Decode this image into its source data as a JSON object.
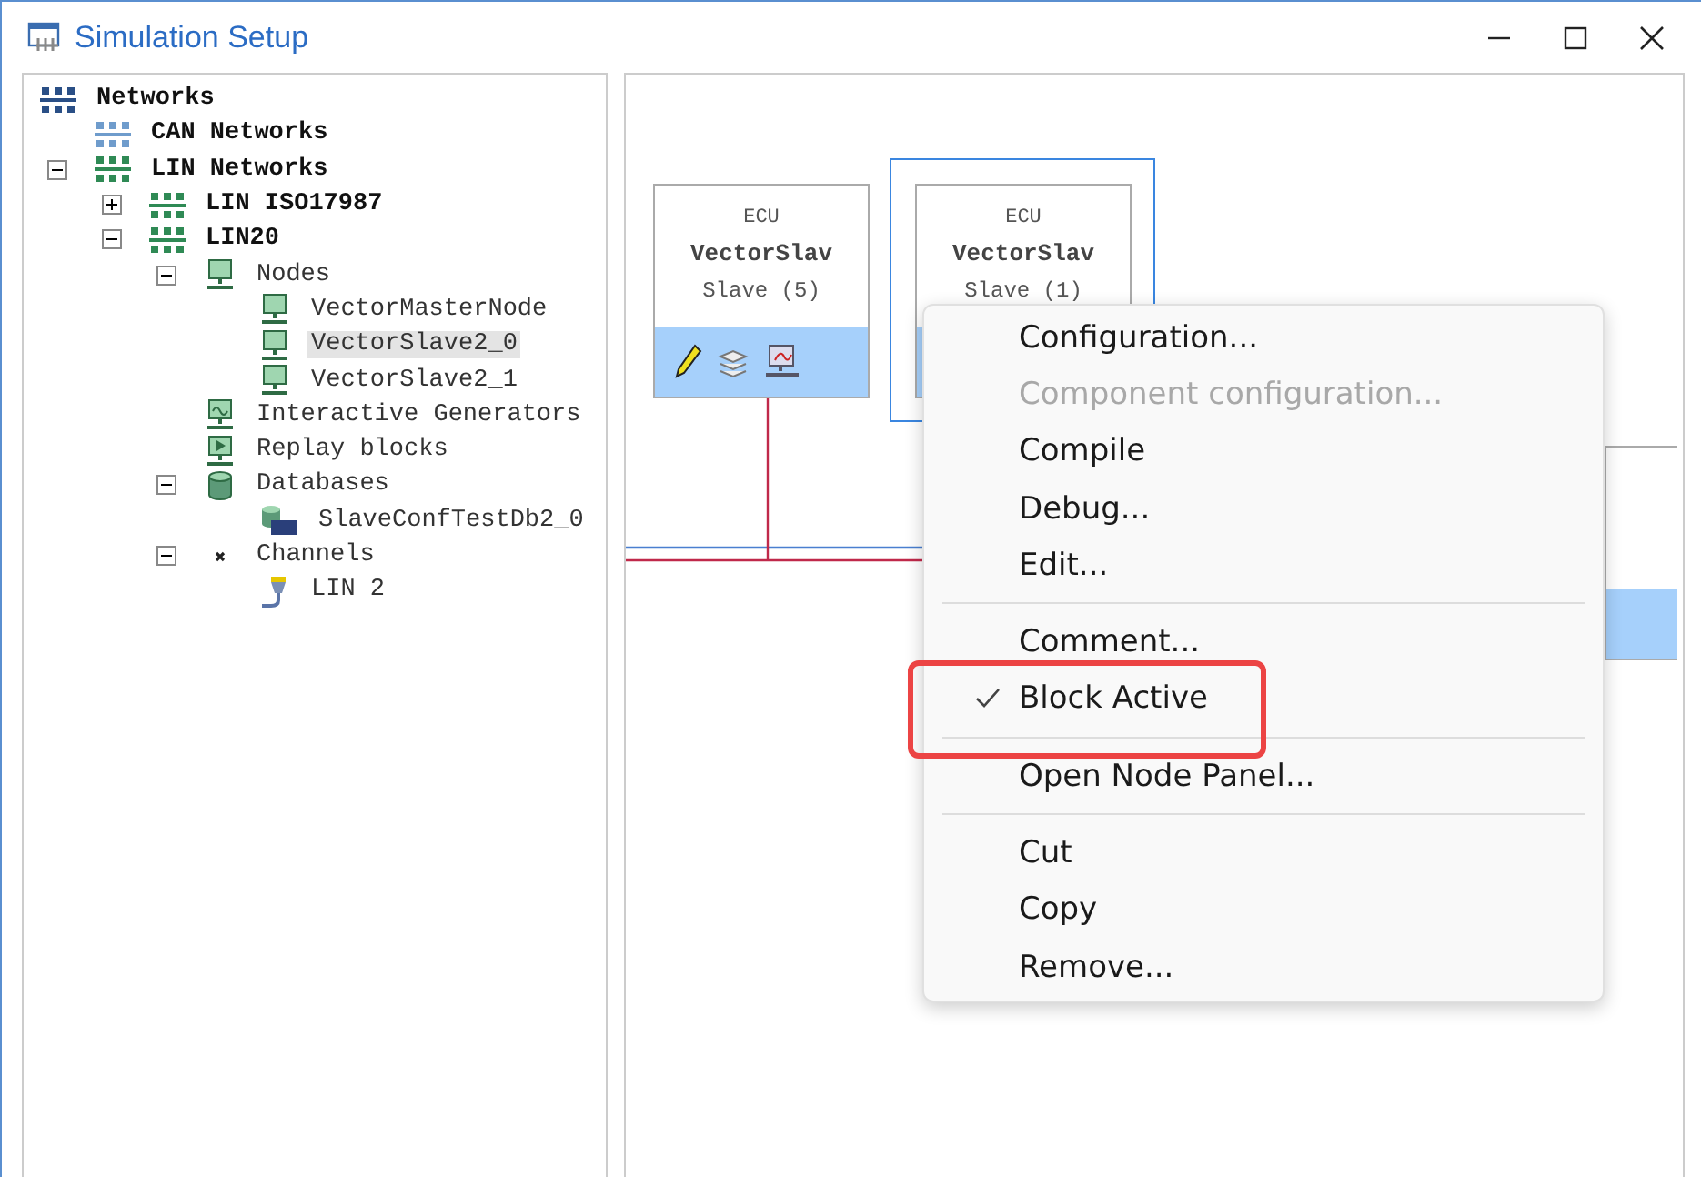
{
  "window": {
    "title": "Simulation Setup"
  },
  "tree": [
    {
      "label": "Networks",
      "kind": "network-root",
      "bold": true,
      "selected": false,
      "children": [
        {
          "label": "CAN Networks",
          "kind": "network-can",
          "bold": true,
          "selected": false
        },
        {
          "label": "LIN Networks",
          "kind": "network-lin",
          "bold": true,
          "selected": false,
          "expanded": true,
          "children": [
            {
              "label": "LIN ISO17987",
              "kind": "network-lin",
              "bold": true,
              "selected": false,
              "expanded": false
            },
            {
              "label": "LIN20",
              "kind": "network-lin",
              "bold": true,
              "selected": false,
              "expanded": true,
              "children": [
                {
                  "label": "Nodes",
                  "kind": "node",
                  "bold": false,
                  "selected": false,
                  "expanded": true,
                  "children": [
                    {
                      "label": "VectorMasterNode",
                      "kind": "node",
                      "bold": false,
                      "selected": false
                    },
                    {
                      "label": "VectorSlave2_0",
                      "kind": "node",
                      "bold": false,
                      "selected": true
                    },
                    {
                      "label": "VectorSlave2_1",
                      "kind": "node",
                      "bold": false,
                      "selected": false
                    }
                  ]
                },
                {
                  "label": "Interactive Generators",
                  "kind": "generator",
                  "bold": false,
                  "selected": false
                },
                {
                  "label": "Replay blocks",
                  "kind": "replay",
                  "bold": false,
                  "selected": false
                },
                {
                  "label": "Databases",
                  "kind": "database",
                  "bold": false,
                  "selected": false,
                  "expanded": true,
                  "children": [
                    {
                      "label": "SlaveConfTestDb2_0",
                      "kind": "ldf",
                      "bold": false,
                      "selected": false
                    }
                  ]
                },
                {
                  "label": "Channels",
                  "kind": "channels",
                  "bold": false,
                  "selected": false,
                  "expanded": true,
                  "children": [
                    {
                      "label": "LIN 2",
                      "kind": "channel",
                      "bold": false,
                      "selected": false
                    }
                  ]
                }
              ]
            }
          ]
        }
      ]
    }
  ],
  "blocks": [
    {
      "type": "ECU",
      "name": "VectorSlav",
      "role": "Slave (5)",
      "selected": false,
      "tools": [
        {
          "kind": "edit"
        },
        {
          "kind": "layers"
        },
        {
          "kind": "monitor"
        }
      ]
    },
    {
      "type": "ECU",
      "name": "VectorSlav",
      "role": "Slave (1)",
      "selected": true
    }
  ],
  "context_menu": [
    {
      "kind": "item",
      "label": "Configuration...",
      "disabled": false,
      "checked": false
    },
    {
      "kind": "item",
      "label": "Component configuration...",
      "disabled": true,
      "checked": false
    },
    {
      "kind": "item",
      "label": "Compile",
      "disabled": false,
      "checked": false
    },
    {
      "kind": "item",
      "label": "Debug...",
      "disabled": false,
      "checked": false
    },
    {
      "kind": "item",
      "label": "Edit...",
      "disabled": false,
      "checked": false
    },
    {
      "kind": "separator"
    },
    {
      "kind": "item",
      "label": "Comment...",
      "disabled": false,
      "checked": false
    },
    {
      "kind": "item",
      "label": "Block Active",
      "disabled": false,
      "checked": true,
      "annotated": true
    },
    {
      "kind": "separator"
    },
    {
      "kind": "item",
      "label": "Open Node Panel...",
      "disabled": false,
      "checked": false
    },
    {
      "kind": "separator"
    },
    {
      "kind": "item",
      "label": "Cut",
      "disabled": false,
      "checked": false
    },
    {
      "kind": "item",
      "label": "Copy",
      "disabled": false,
      "checked": false
    },
    {
      "kind": "item",
      "label": "Remove...",
      "disabled": false,
      "checked": false
    }
  ]
}
